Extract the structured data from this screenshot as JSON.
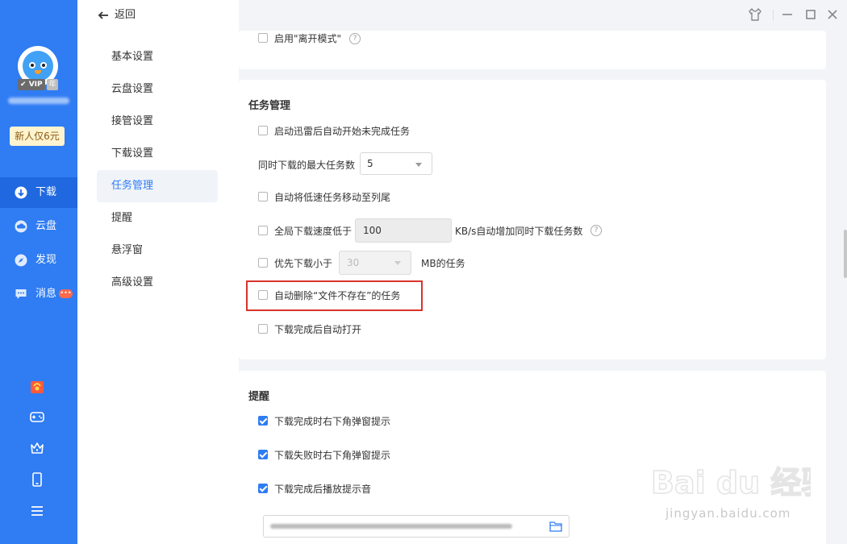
{
  "sidebar": {
    "vip_label": "VIP",
    "vip_year": "年",
    "promo": "新人仅6元",
    "nav": [
      {
        "label": "下载",
        "icon": "download-icon",
        "active": true
      },
      {
        "label": "云盘",
        "icon": "cloud-icon",
        "active": false
      },
      {
        "label": "发现",
        "icon": "compass-icon",
        "active": false
      },
      {
        "label": "消息",
        "icon": "message-icon",
        "active": false,
        "badge": "•••"
      }
    ],
    "bottom_icons": [
      "gift-icon",
      "gamepad-icon",
      "crown-icon",
      "phone-icon",
      "menu-icon"
    ]
  },
  "header": {
    "back_label": "返回",
    "window_controls": [
      "skin-icon",
      "minimize-icon",
      "maximize-icon",
      "close-icon"
    ]
  },
  "menu": {
    "items": [
      "基本设置",
      "云盘设置",
      "接管设置",
      "下载设置",
      "任务管理",
      "提醒",
      "悬浮窗",
      "高级设置"
    ],
    "active_index": 4
  },
  "content": {
    "top": {
      "away_mode_label": "启用\"离开模式\"",
      "away_mode_checked": false
    },
    "task": {
      "title": "任务管理",
      "auto_start_label": "启动迅雷后自动开始未完成任务",
      "max_tasks_label": "同时下载的最大任务数",
      "max_tasks_value": "5",
      "move_slow_label": "自动将低速任务移动至列尾",
      "speed_prefix": "全局下载速度低于",
      "speed_value": "100",
      "speed_suffix": "KB/s自动增加同时下载任务数",
      "small_first_label": "优先下载小于",
      "small_first_value": "30",
      "small_first_suffix": "MB的任务",
      "auto_delete_label": "自动删除“文件不存在”的任务",
      "auto_open_label": "下载完成后自动打开"
    },
    "remind": {
      "title": "提醒",
      "items": [
        {
          "label": "下载完成时右下角弹窗提示",
          "checked": true
        },
        {
          "label": "下载失败时右下角弹窗提示",
          "checked": true
        },
        {
          "label": "下载完成后播放提示音",
          "checked": true
        }
      ],
      "folder_icon": "folder-icon"
    }
  },
  "watermark": {
    "brand": "Bai du 经验",
    "url": "jingyan.baidu.com"
  },
  "colors": {
    "sidebar_blue": "#2f7cf3",
    "active_blue": "#1f68e0",
    "highlight_red": "#d9332b"
  }
}
